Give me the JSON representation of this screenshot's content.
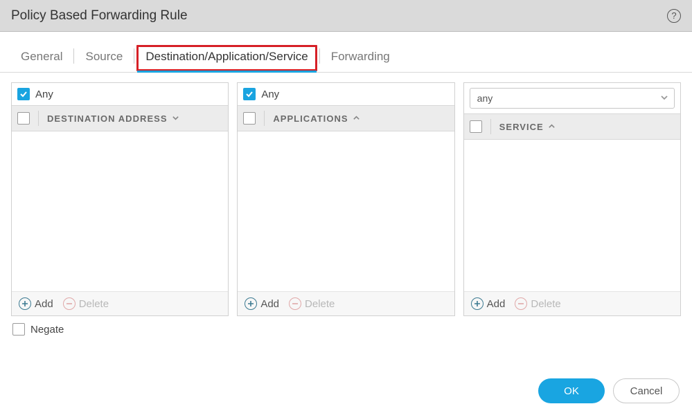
{
  "dialog": {
    "title": "Policy Based Forwarding Rule"
  },
  "tabs": {
    "general": "General",
    "source": "Source",
    "dest": "Destination/Application/Service",
    "forwarding": "Forwarding"
  },
  "panels": {
    "destination": {
      "any_label": "Any",
      "any_checked": true,
      "header": "Destination Address",
      "sort": "desc",
      "add": "Add",
      "delete": "Delete"
    },
    "applications": {
      "any_label": "Any",
      "any_checked": true,
      "header": "Applications",
      "sort": "asc",
      "add": "Add",
      "delete": "Delete"
    },
    "service": {
      "select_value": "any",
      "header": "Service",
      "sort": "asc",
      "add": "Add",
      "delete": "Delete"
    }
  },
  "negate": {
    "label": "Negate",
    "checked": false
  },
  "footer": {
    "ok": "OK",
    "cancel": "Cancel"
  }
}
